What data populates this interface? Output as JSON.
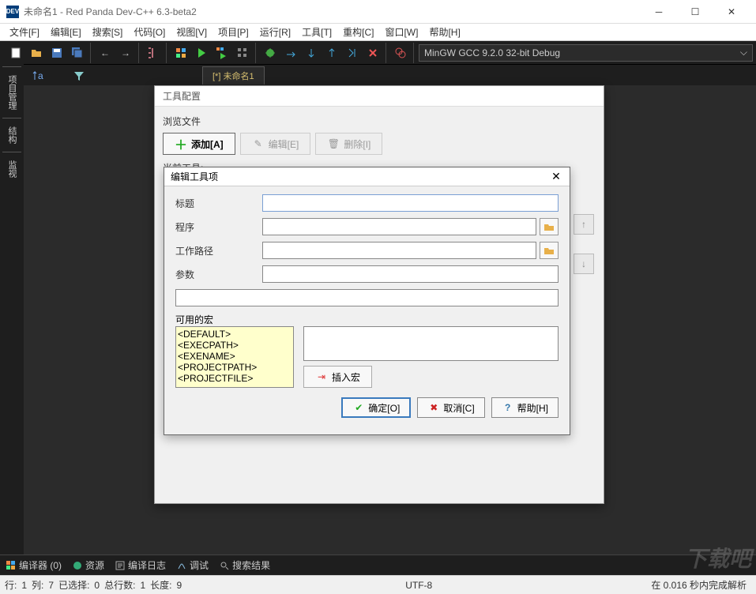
{
  "titlebar": {
    "title": "未命名1 - Red Panda Dev-C++ 6.3-beta2",
    "app_icon_text": "DEV"
  },
  "menu": {
    "items": [
      "文件[F]",
      "编辑[E]",
      "搜索[S]",
      "代码[O]",
      "视图[V]",
      "项目[P]",
      "运行[R]",
      "工具[T]",
      "重构[C]",
      "窗口[W]",
      "帮助[H]"
    ]
  },
  "compiler_select": "MinGW GCC 9.2.0 32-bit Debug",
  "editor_tab": "[*] 未命名1",
  "side_tabs": [
    "项目管理",
    "结构",
    "监视"
  ],
  "bottom_tabs": {
    "compiler": "编译器 (0)",
    "resource": "资源",
    "compile_log": "编译日志",
    "debug": "调试",
    "search_results": "搜索结果"
  },
  "statusbar": {
    "line_lbl": "行:",
    "line_val": "1",
    "col_lbl": "列:",
    "col_val": "7",
    "sel_lbl": "已选择:",
    "sel_val": "0",
    "total_lbl": "总行数:",
    "total_val": "1",
    "len_lbl": "长度:",
    "len_val": "9",
    "encoding": "UTF-8",
    "timing": "在 0.016 秒内完成解析"
  },
  "tools_dialog": {
    "title": "工具配置",
    "browse_label": "浏览文件",
    "add_btn": "添加[A]",
    "edit_btn": "编辑[E]",
    "delete_btn": "删除[I]",
    "current_label": "当前工具:"
  },
  "edit_dialog": {
    "title": "编辑工具项",
    "fields": {
      "title": "标题",
      "program": "程序",
      "workdir": "工作路径",
      "params": "参数"
    },
    "macros_label": "可用的宏",
    "macros": [
      "<DEFAULT>",
      "<EXECPATH>",
      "<EXENAME>",
      "<PROJECTPATH>",
      "<PROJECTFILE>"
    ],
    "insert_macro": "插入宏",
    "ok": "确定[O]",
    "cancel": "取消[C]",
    "help": "帮助[H]"
  },
  "watermark": "下载吧"
}
